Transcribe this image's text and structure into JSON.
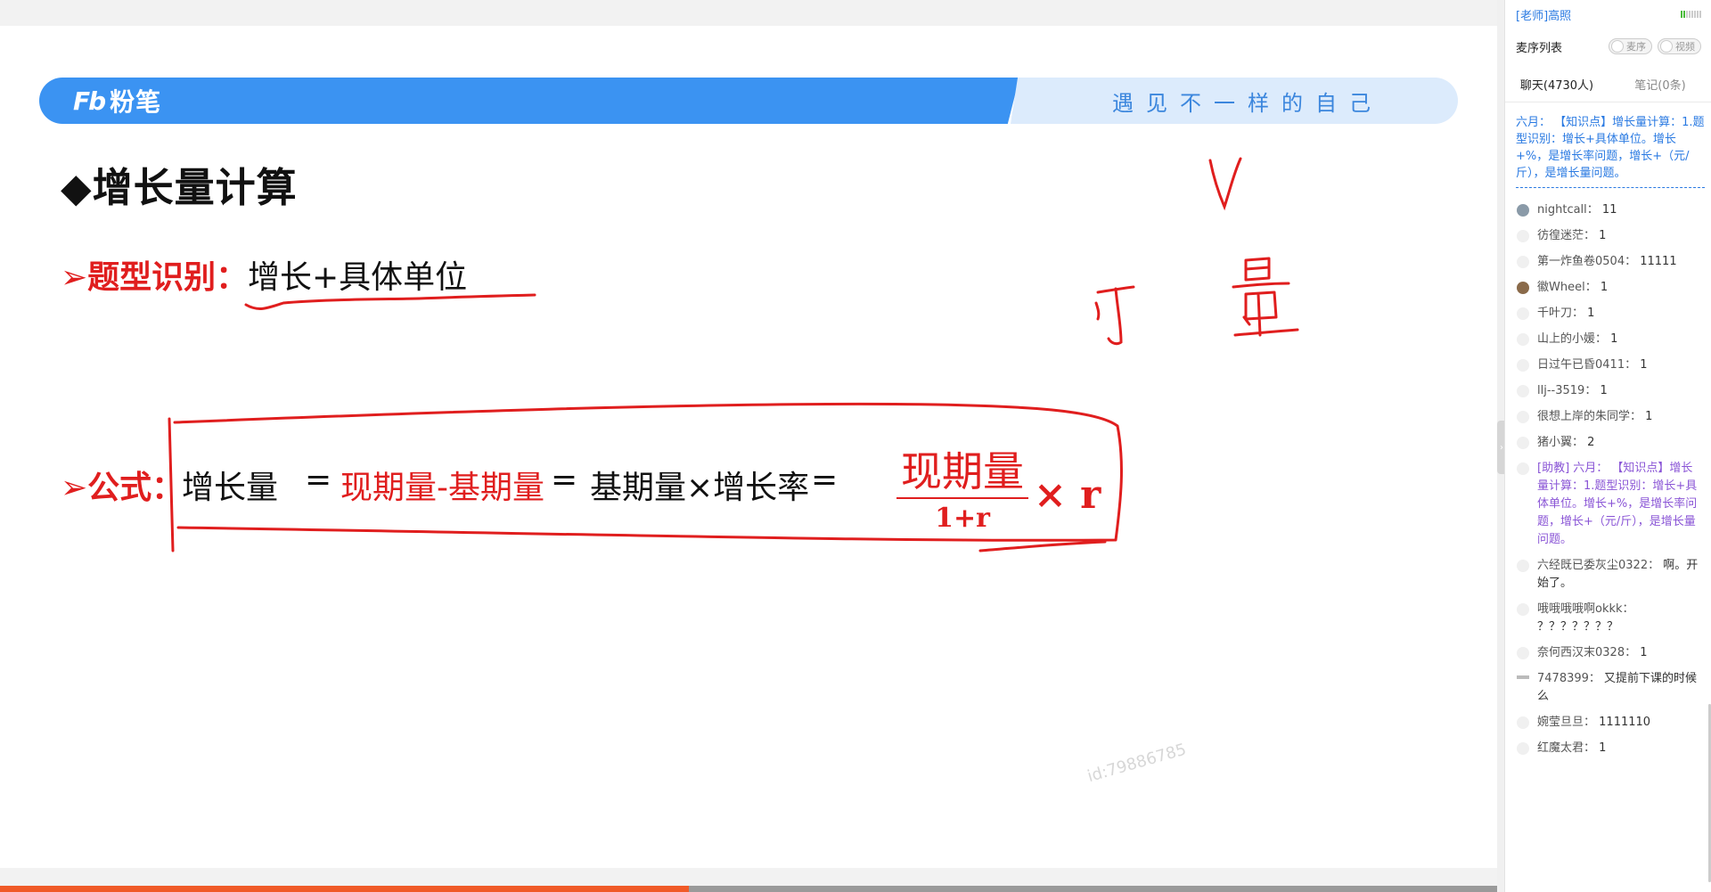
{
  "slide": {
    "logo_mark": "Fb",
    "logo_text": "粉笔",
    "slogan": "遇见不一样的自己",
    "title": "◆增长量计算",
    "type_label": "➢题型识别：",
    "type_text": "增长+具体单位",
    "formula_label": "➢公式：",
    "formula_part1": "增长量",
    "formula_eq1": "=",
    "formula_part2": "现期量-基期量",
    "formula_eq2": "=",
    "formula_part3": "基期量×增长率",
    "formula_eq3": "=",
    "fraction_num": "现期量",
    "fraction_den": "1+r",
    "times_r": "× r",
    "watermark": "id:79886785",
    "progress_fraction": 0.46
  },
  "panel": {
    "teacher": "[老师]高照",
    "mic_title": "麦序列表",
    "toggle_mic": "麦序",
    "toggle_video": "视频",
    "tab_chat": "聊天(4730人)",
    "tab_notes": "笔记(0条)",
    "notice": "六月：  【知识点】增长量计算：1.题型识别：增长+具体单位。增长+%，是增长率问题，增长+（元/斤），是增长量问题。",
    "messages": [
      {
        "user": "nightcall",
        "text": "11",
        "avatar": "img"
      },
      {
        "user": "彷徨迷茫",
        "text": "1",
        "avatar": "blank"
      },
      {
        "user": "第一炸鱼卷0504",
        "text": "11111",
        "avatar": "blank"
      },
      {
        "user": "徽Wheel",
        "text": "1",
        "avatar": "img2"
      },
      {
        "user": "千叶刀",
        "text": "1",
        "avatar": "blank"
      },
      {
        "user": "山上的小媛",
        "text": "1",
        "avatar": "blank"
      },
      {
        "user": "日过午已昏0411",
        "text": "1",
        "avatar": "blank"
      },
      {
        "user": "llj--3519",
        "text": "1",
        "avatar": "blank"
      },
      {
        "user": "很想上岸的朱同学",
        "text": "1",
        "avatar": "blank"
      },
      {
        "user": "猪小翼",
        "text": "2",
        "avatar": "blank"
      },
      {
        "user": "[助教] 六月",
        "text": "【知识点】增长量计算：1.题型识别：增长+具体单位。增长+%，是增长率问题，增长+（元/斤），是增长量问题。",
        "avatar": "blank",
        "assist": true
      },
      {
        "user": "六经既已委灰尘0322",
        "text": "啊。开始了。",
        "avatar": "blank"
      },
      {
        "user": "哦哦哦哦啊okkk",
        "text": "？？？？？？？",
        "avatar": "blank"
      },
      {
        "user": "奈何西汉末0328",
        "text": "1",
        "avatar": "blank"
      },
      {
        "user": "7478399",
        "text": "又提前下课的时候么",
        "avatar": "flat"
      },
      {
        "user": "婉莹旦旦",
        "text": "1111110",
        "avatar": "blank"
      },
      {
        "user": "红魔太君",
        "text": "1",
        "avatar": "blank"
      }
    ]
  },
  "colors": {
    "brand_blue": "#3b93f2",
    "accent_red": "#e01e1e",
    "progress_orange": "#f05a28",
    "link_blue": "#2a7ae2",
    "assistant_purple": "#8a55d6"
  }
}
